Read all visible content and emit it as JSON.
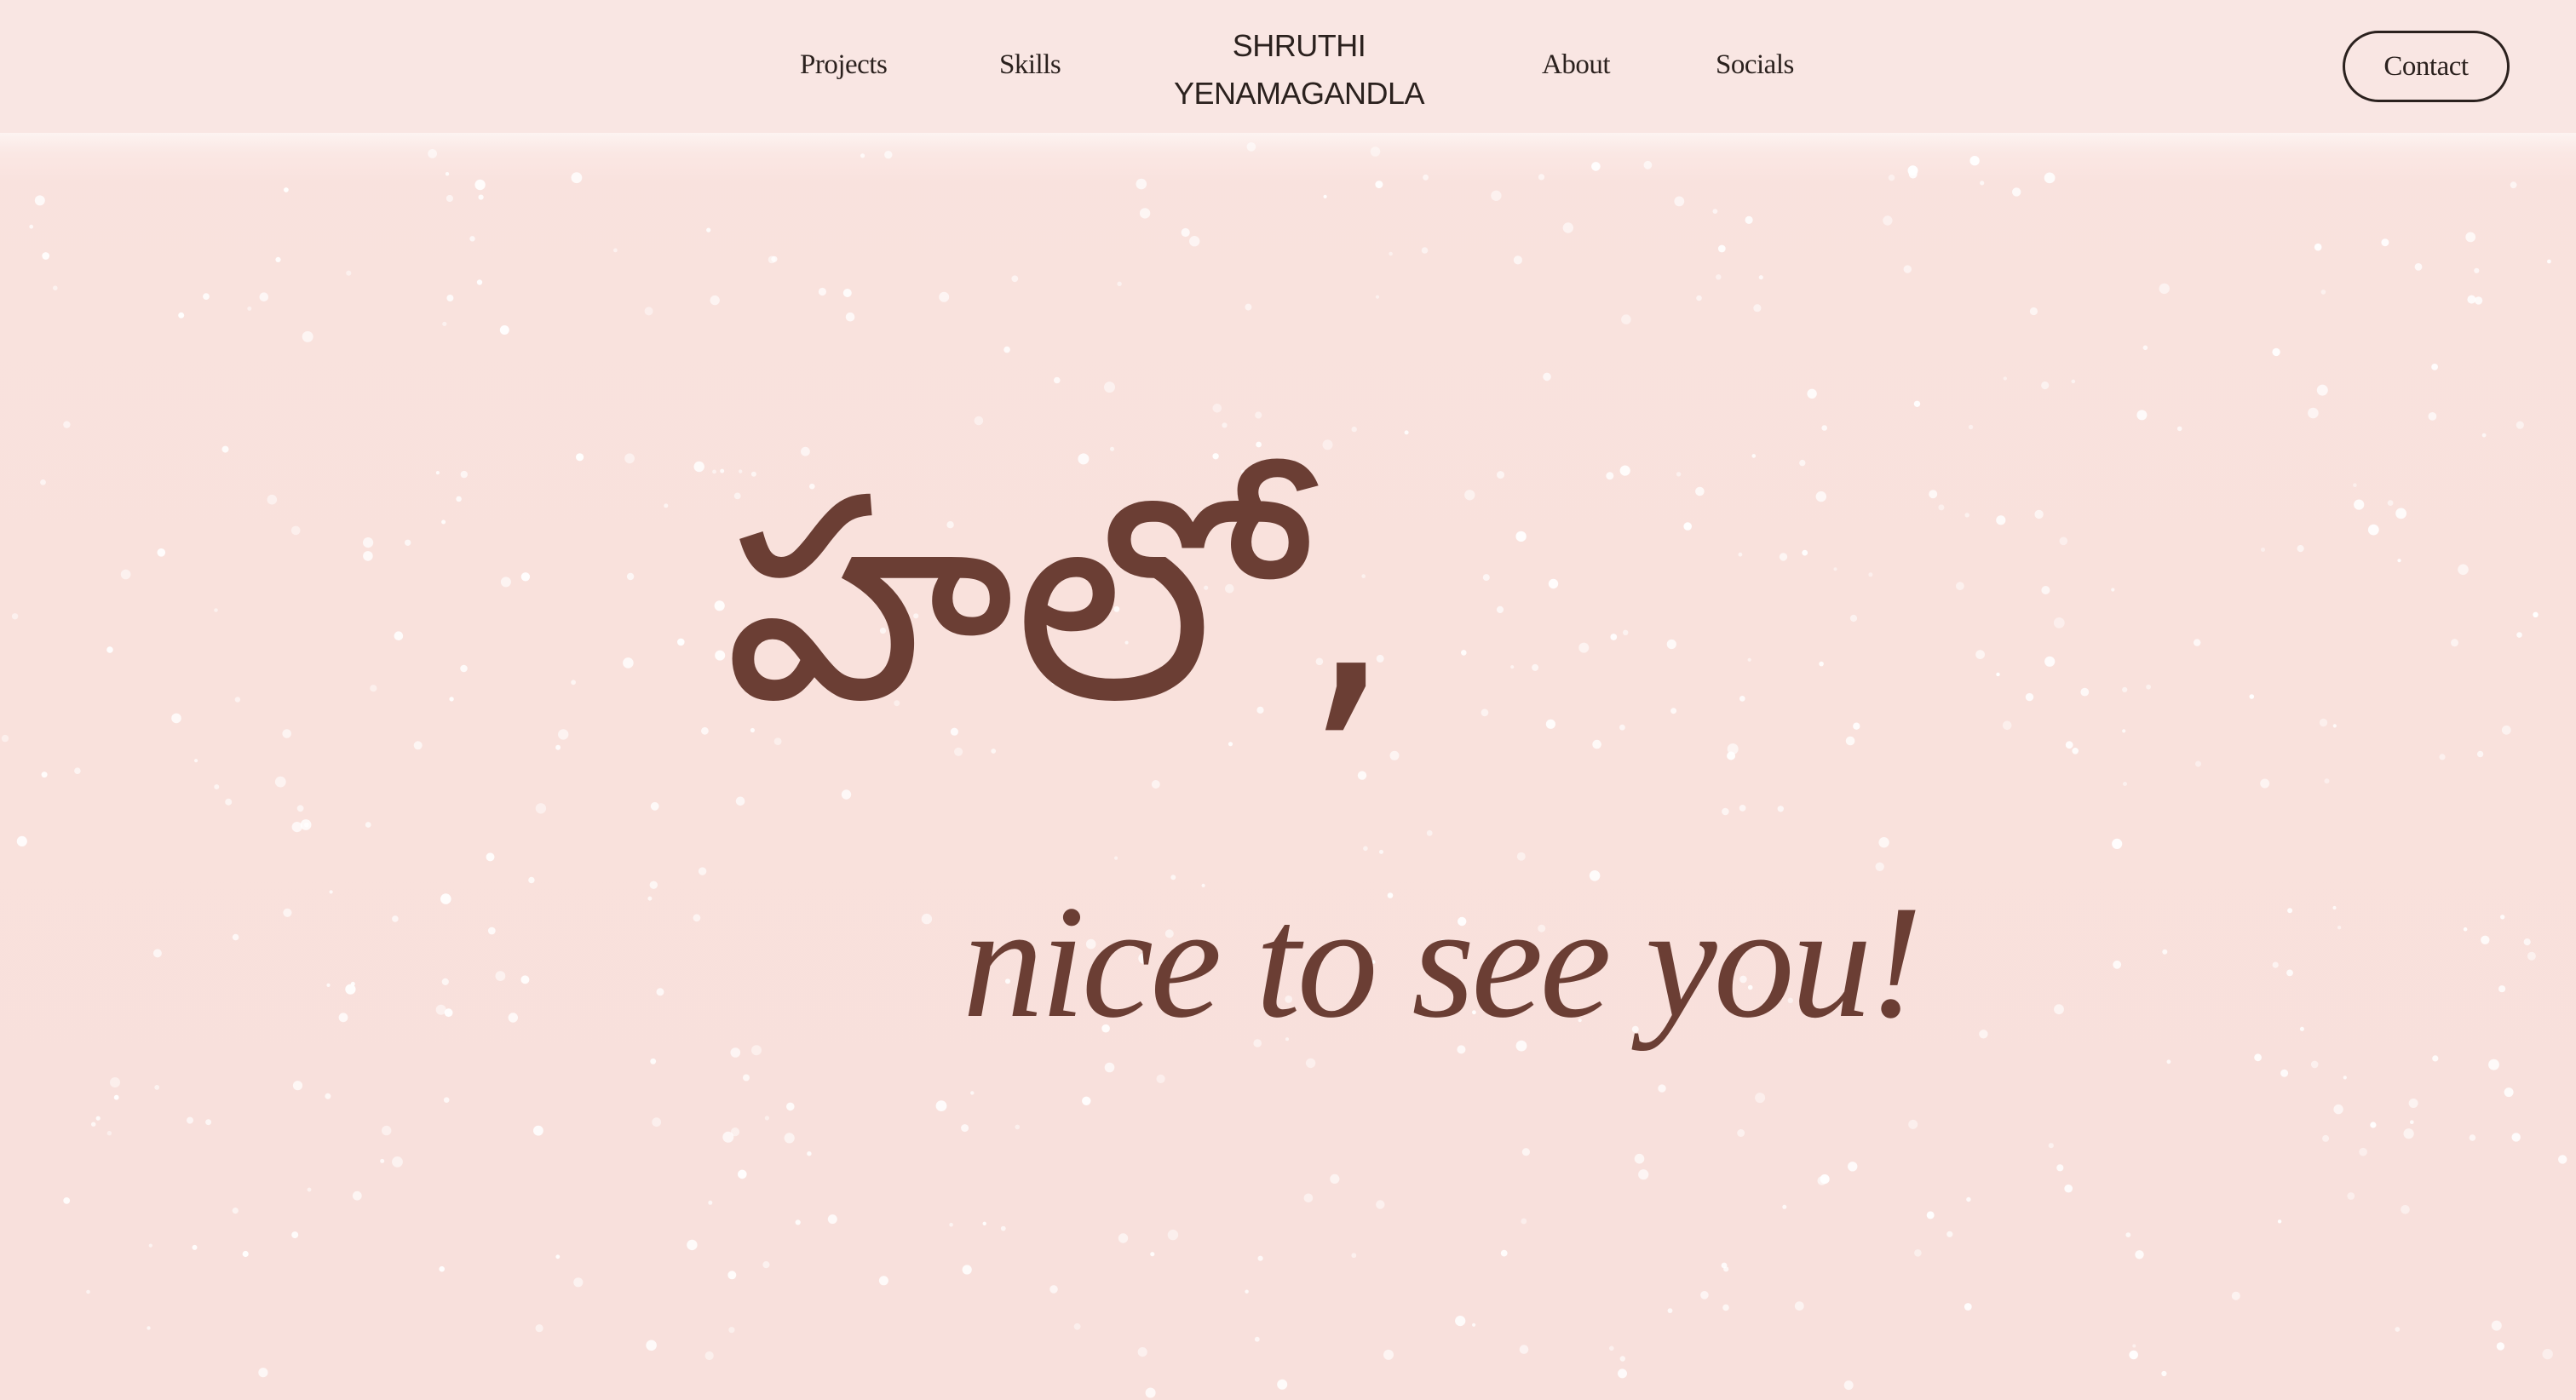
{
  "nav": {
    "projects": "Projects",
    "skills": "Skills",
    "about": "About",
    "socials": "Socials",
    "contact": "Contact"
  },
  "logo": {
    "line1": "SHRUTHI",
    "line2": "YENAMAGANDLA"
  },
  "hero": {
    "greeting": "హలో,",
    "tagline": "nice to see you!"
  },
  "colors": {
    "background": "#f9e1dc",
    "header": "#f9e6e3",
    "hero_text": "#6b3e34",
    "nav_text": "#2b211e"
  }
}
